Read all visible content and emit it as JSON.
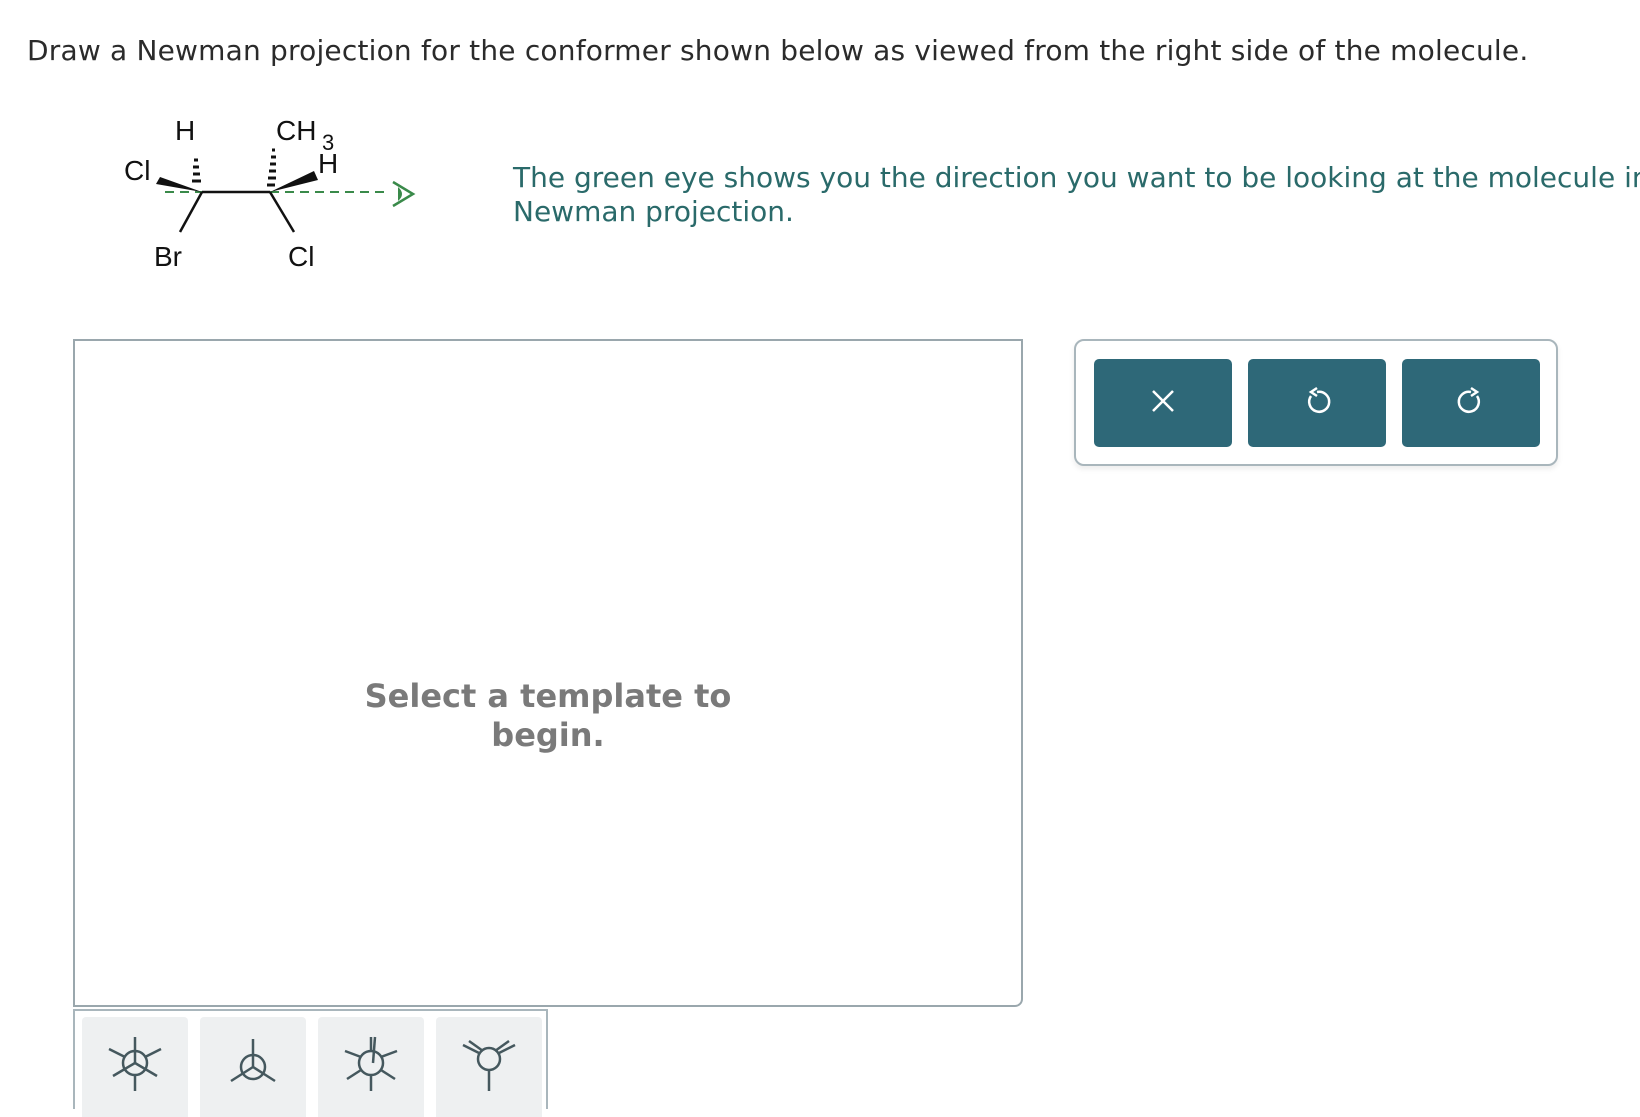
{
  "question": "Draw a Newman projection for the conformer shown below as viewed from the right side of the molecule.",
  "molecule": {
    "labels": {
      "left_top": "H",
      "left_upper": "Cl",
      "left_bottom": "Br",
      "right_top": "CH",
      "right_top_sub": "3",
      "right_upper": "H",
      "right_bottom": "Cl"
    },
    "eye_color": "#3a8a4a"
  },
  "note": "The green eye shows you the direction you want to be looking at the molecule in\nNewman projection.",
  "canvas": {
    "placeholder": "Select a template to\nbegin."
  },
  "toolbar": {
    "buttons": [
      {
        "name": "clear",
        "icon": "close-icon"
      },
      {
        "name": "undo",
        "icon": "undo-icon"
      },
      {
        "name": "redo",
        "icon": "redo-icon"
      }
    ],
    "button_color": "#2e6878"
  },
  "templates": [
    {
      "name": "staggered-template",
      "icon": "newman-staggered-icon"
    },
    {
      "name": "three-bond-template",
      "icon": "newman-three-bond-icon"
    },
    {
      "name": "eclipsed-template",
      "icon": "newman-eclipsed-icon"
    },
    {
      "name": "eclipsed-alt-template",
      "icon": "newman-eclipsed-alt-icon"
    }
  ]
}
